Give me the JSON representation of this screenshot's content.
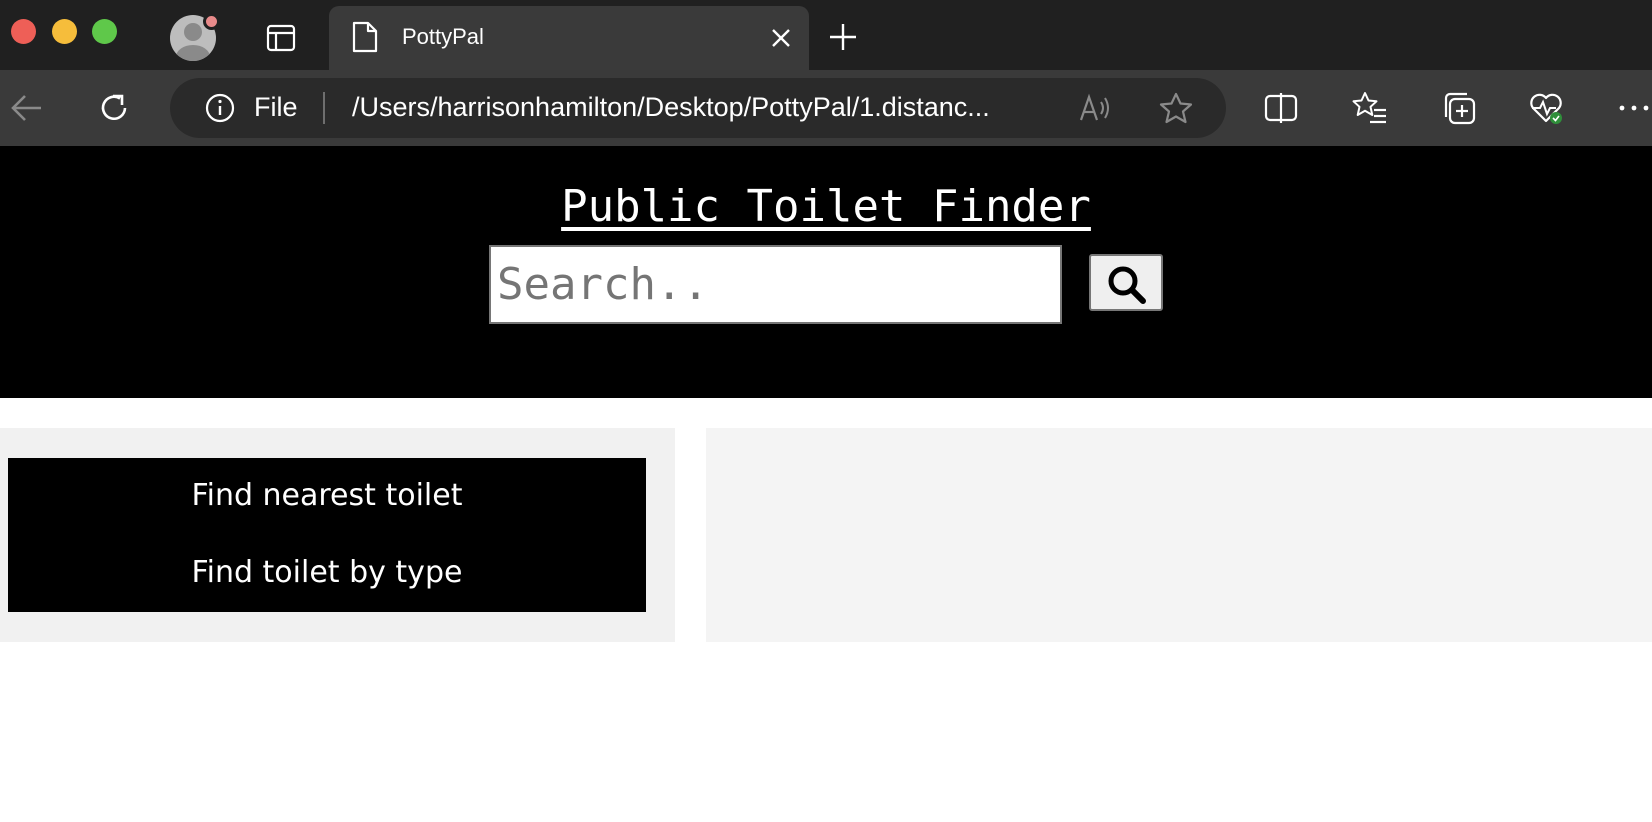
{
  "browser": {
    "tab": {
      "title": "PottyPal"
    },
    "address_bar": {
      "scheme_label": "File",
      "url": "/Users/harrisonhamilton/Desktop/PottyPal/1.distanc..."
    },
    "icons": {
      "back": "arrow-left-icon",
      "reload": "reload-icon",
      "info": "info-icon",
      "read_aloud": "read-aloud-icon",
      "favorite": "star-icon",
      "split_screen": "split-screen-icon",
      "favorites": "favorites-list-icon",
      "collections": "collections-icon",
      "health": "browser-essentials-icon",
      "more": "more-icon"
    }
  },
  "header": {
    "title": "Public Toilet Finder",
    "search": {
      "placeholder": "Search..",
      "value": ""
    }
  },
  "menu": {
    "items": [
      {
        "label": "Find nearest toilet"
      },
      {
        "label": "Find toilet by type"
      }
    ]
  },
  "colors": {
    "header_bg": "#000000",
    "menu_panel_bg": "#f1f1f1",
    "results_panel_bg": "#f4f4f4",
    "chrome_tabstrip": "#202020",
    "chrome_toolbar": "#3a3a3a"
  }
}
